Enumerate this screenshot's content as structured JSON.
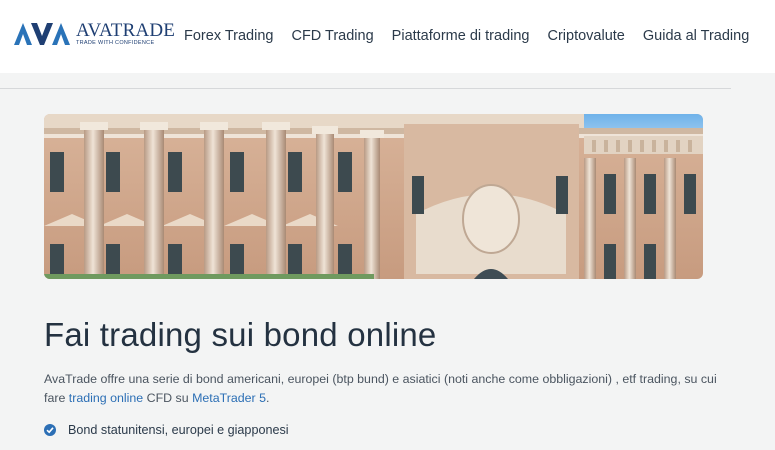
{
  "header": {
    "logo": {
      "word": "AVATRADE",
      "tagline": "TRADE WITH CONFIDENCE"
    },
    "nav": [
      {
        "label": "Forex Trading"
      },
      {
        "label": "CFD Trading"
      },
      {
        "label": "Piattaforme di trading"
      },
      {
        "label": "Criptovalute"
      },
      {
        "label": "Guida al Trading"
      }
    ]
  },
  "main": {
    "title": "Fai trading sui bond online",
    "intro": {
      "text_before": "AvaTrade offre una serie di bond americani, europei (btp bund) e asiatici (noti anche come obbligazioni) , etf trading, su cui fare ",
      "link1": "trading online",
      "text_middle": " CFD su ",
      "link2": "MetaTrader 5",
      "text_after": "."
    },
    "bullets": [
      {
        "text": "Bond statunitensi, europei e giapponesi"
      }
    ]
  },
  "colors": {
    "brand": "#1f3f73",
    "link": "#2c6fb5",
    "page_bg": "#f3f4f4"
  },
  "icons": {
    "logo": "ava-logo-mark",
    "bullet": "check-circle-icon"
  }
}
